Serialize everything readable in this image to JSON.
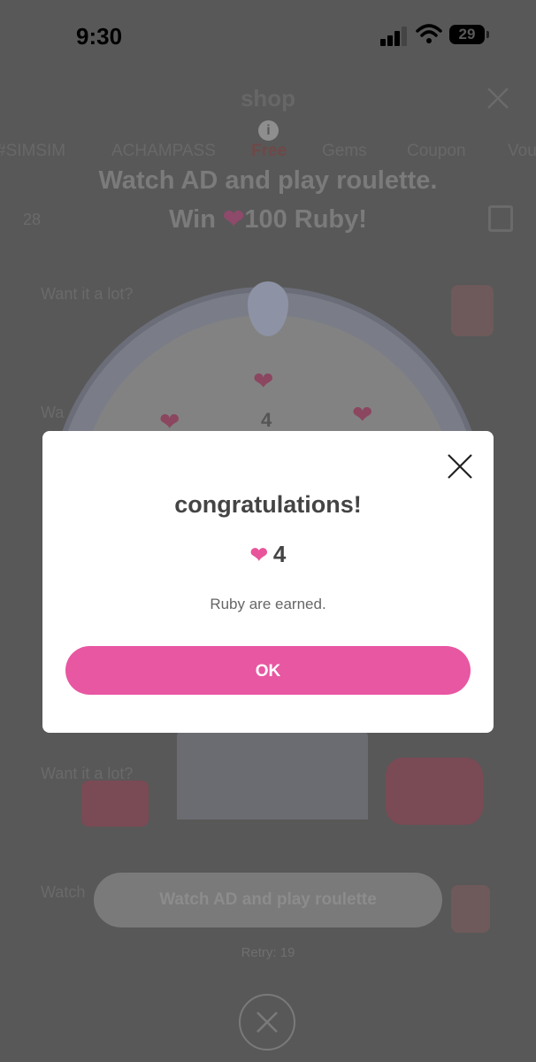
{
  "status_bar": {
    "time": "9:30",
    "battery": "29"
  },
  "shop": {
    "title": "shop",
    "tabs": [
      "#SIMSIM",
      "ACHAMPASS",
      "Free",
      "Gems",
      "Coupon",
      "Vou"
    ],
    "headline_line1": "Watch AD and play roulette.",
    "headline_line2_a": "Win",
    "headline_line2_b": "100 Ruby!",
    "balance": "28",
    "rows": [
      {
        "label": "Want it a lot?",
        "sub": ""
      },
      {
        "label": "Wa",
        "sub": ""
      },
      {
        "label": "Want it a lot?",
        "sub": ""
      },
      {
        "label": "Watch",
        "sub": ""
      }
    ],
    "wheel_value": "4",
    "watch_button": "Watch AD and play roulette",
    "retry": "Retry: 19"
  },
  "modal": {
    "title": "congratulations!",
    "reward_amount": "4",
    "message": "Ruby are earned.",
    "ok_label": "OK"
  },
  "colors": {
    "accent": "#e857a2",
    "heart": "#e8559b",
    "overlay": "#585858"
  },
  "icons": [
    "info-icon",
    "close-icon",
    "heart-icon",
    "cart-icon",
    "signal-icon",
    "wifi-icon",
    "battery-icon"
  ]
}
